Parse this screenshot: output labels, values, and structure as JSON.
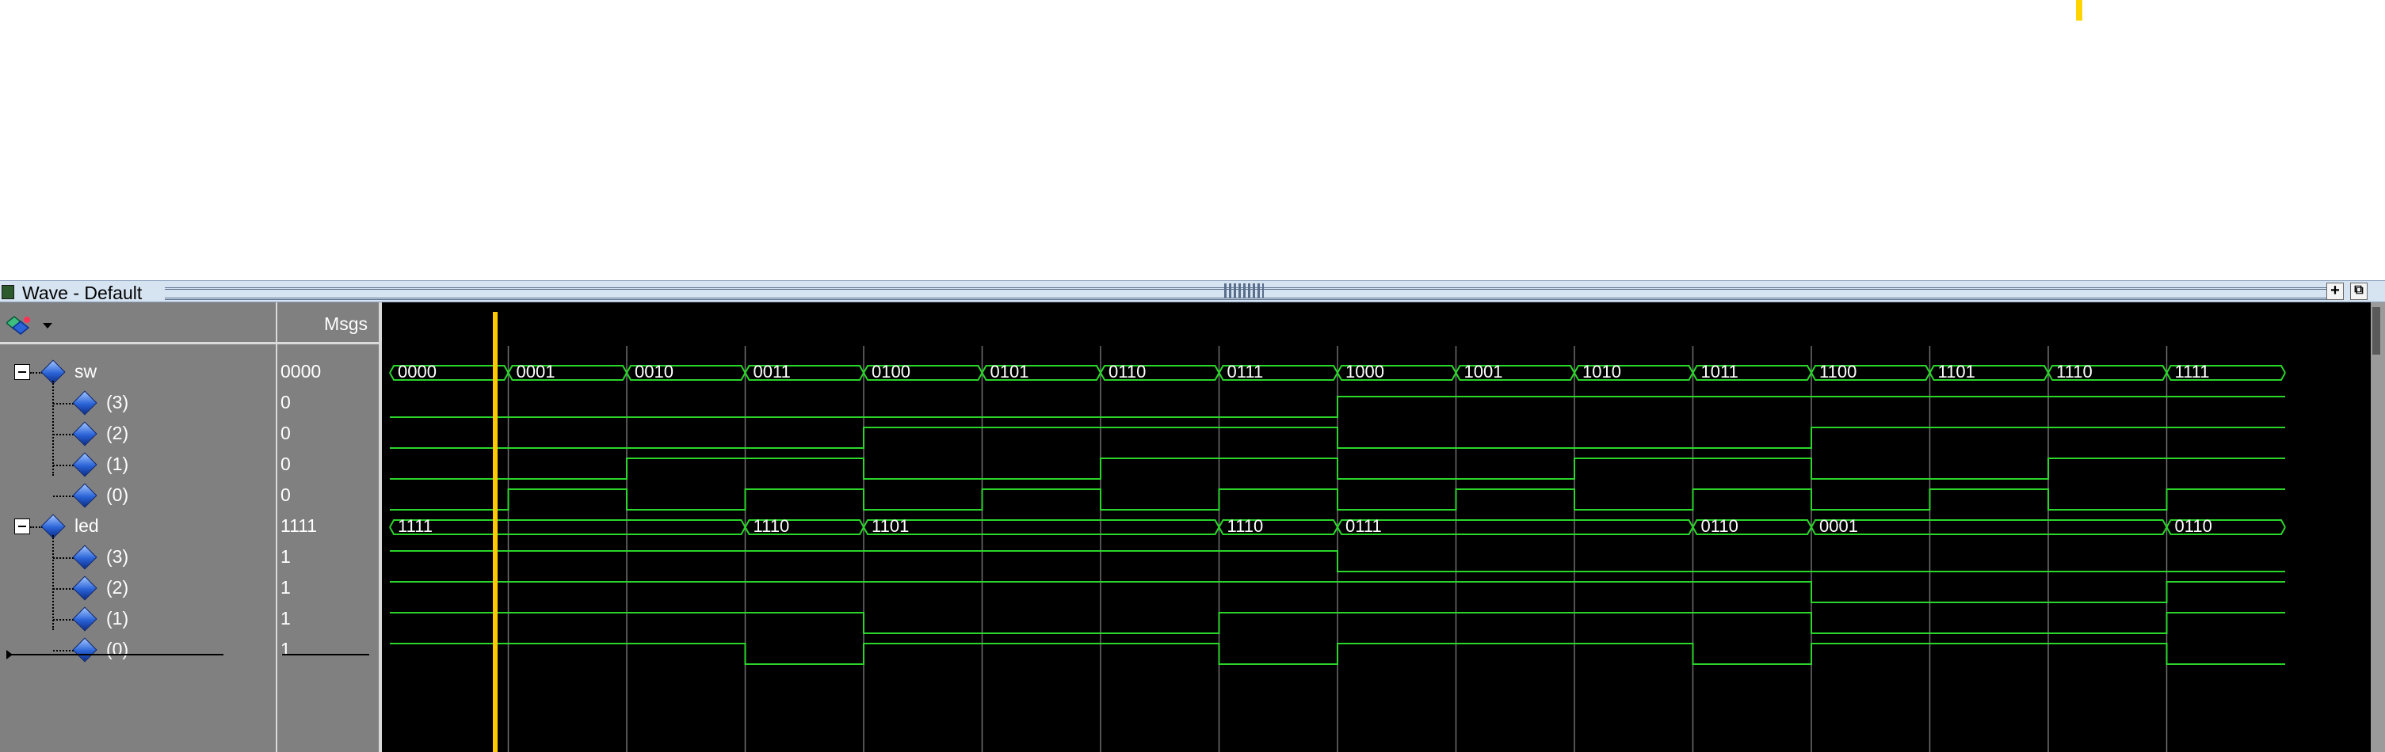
{
  "window": {
    "title": "Wave - Default",
    "btn_add": "+",
    "btn_undock": "⧉"
  },
  "header": {
    "msgs": "Msgs"
  },
  "signals": [
    {
      "name": "sw",
      "value": "0000",
      "expandable": true
    },
    {
      "name": "(3)",
      "value": "0"
    },
    {
      "name": "(2)",
      "value": "0"
    },
    {
      "name": "(1)",
      "value": "0"
    },
    {
      "name": "(0)",
      "value": "0"
    },
    {
      "name": "led",
      "value": "1111",
      "expandable": true
    },
    {
      "name": "(3)",
      "value": "1"
    },
    {
      "name": "(2)",
      "value": "1"
    },
    {
      "name": "(1)",
      "value": "1"
    },
    {
      "name": "(0)",
      "value": "1"
    }
  ],
  "waveform": {
    "time_slots": 16,
    "sw_bus": [
      "0000",
      "0001",
      "0010",
      "0011",
      "0100",
      "0101",
      "0110",
      "0111",
      "1000",
      "1001",
      "1010",
      "1011",
      "1100",
      "1101",
      "1110",
      "1111"
    ],
    "led_bus_segments": [
      {
        "start": 0,
        "end": 3,
        "value": "1111"
      },
      {
        "start": 3,
        "end": 4,
        "value": "1110"
      },
      {
        "start": 4,
        "end": 7,
        "value": "1101"
      },
      {
        "start": 7,
        "end": 8,
        "value": "1110"
      },
      {
        "start": 8,
        "end": 11,
        "value": "0111"
      },
      {
        "start": 11,
        "end": 12,
        "value": "0110"
      },
      {
        "start": 12,
        "end": 15,
        "value": "0001"
      },
      {
        "start": 15,
        "end": 16,
        "value": "0110"
      }
    ],
    "led_bits": [
      [
        1,
        1,
        1,
        1,
        1,
        1,
        1,
        1,
        0,
        0,
        0,
        0,
        0,
        0,
        0,
        0
      ],
      [
        1,
        1,
        1,
        1,
        1,
        1,
        1,
        1,
        1,
        1,
        1,
        1,
        0,
        0,
        0,
        1
      ],
      [
        1,
        1,
        1,
        1,
        0,
        0,
        0,
        1,
        1,
        1,
        1,
        1,
        0,
        0,
        0,
        1
      ],
      [
        1,
        1,
        1,
        0,
        1,
        1,
        1,
        0,
        1,
        1,
        1,
        0,
        1,
        1,
        1,
        0
      ]
    ],
    "cursor_slot": 0.9,
    "colors": {
      "wave": "#2bd62b",
      "grid": "#6e6e6e",
      "bus_text": "#ffffff",
      "cursor": "#ffc800"
    }
  }
}
